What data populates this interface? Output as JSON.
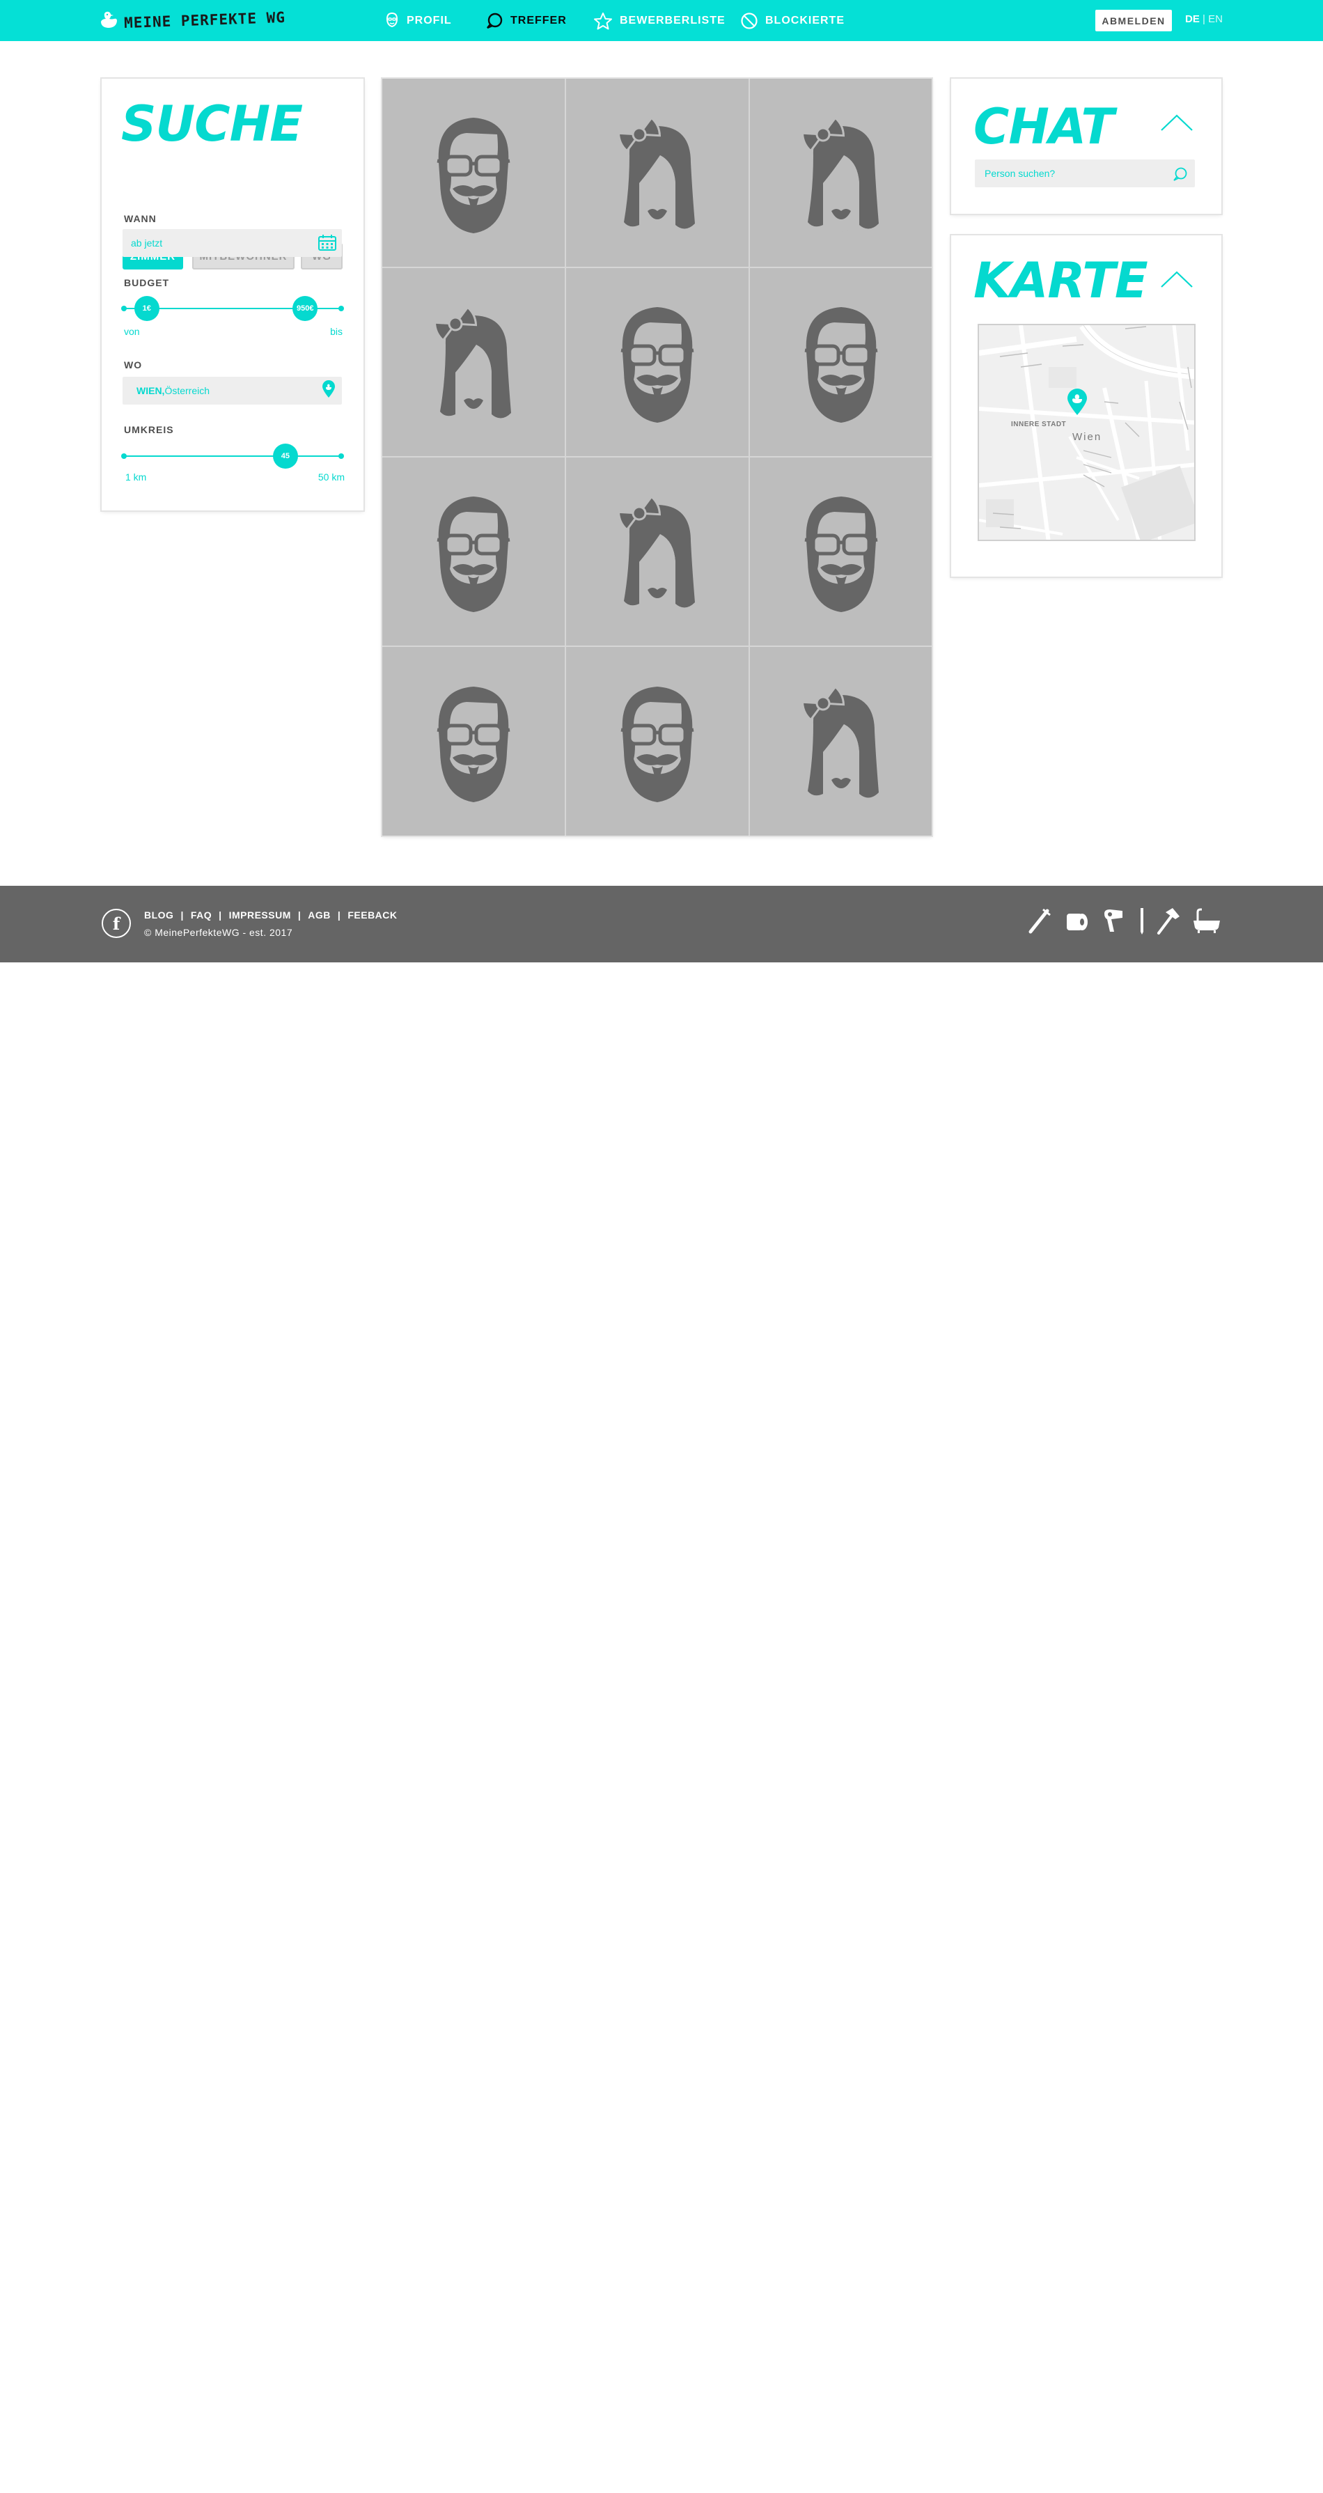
{
  "header": {
    "brand": "Meine Perfekte WG",
    "nav": [
      {
        "label": "PROFIL",
        "icon": "face-icon",
        "active": false
      },
      {
        "label": "TREFFER",
        "icon": "chat-bubble-icon",
        "active": true
      },
      {
        "label": "BEWERBERLISTE",
        "icon": "star-icon",
        "active": false
      },
      {
        "label": "BLOCKIERTE",
        "icon": "block-icon",
        "active": false
      }
    ],
    "logout_label": "ABMELDEN",
    "lang_de": "DE",
    "lang_sep": " | ",
    "lang_en": "EN"
  },
  "search": {
    "title": "SUCHE",
    "tabs": [
      {
        "label": "ZIMMER",
        "selected": true
      },
      {
        "label": "MITBEWOHNER",
        "selected": false
      },
      {
        "label": "WG",
        "selected": false
      }
    ],
    "when_label": "WANN",
    "when_value": "ab jetzt",
    "budget_label": "BUDGET",
    "budget_min": "1€",
    "budget_max": "950€",
    "budget_from": "von",
    "budget_to": "bis",
    "budget_min_fraction": 0.11,
    "budget_max_fraction": 0.83,
    "where_label": "WO",
    "where_city": "WIEN,",
    "where_country": " Österreich",
    "radius_label": "UMKREIS",
    "radius_value": "45",
    "radius_fraction": 0.74,
    "radius_min": "1 km",
    "radius_max": "50 km"
  },
  "matches": [
    "male",
    "female",
    "female",
    "female",
    "male",
    "male",
    "male",
    "female",
    "male",
    "male",
    "male",
    "female"
  ],
  "chat": {
    "title": "CHAT",
    "placeholder": "Person suchen?"
  },
  "map": {
    "title": "KARTE",
    "district": "INNERE STADT",
    "city": "Wien"
  },
  "footer": {
    "facebook": "f",
    "links": [
      "BLOG",
      "FAQ",
      "IMPRESSUM",
      "AGB",
      "FEEBACK"
    ],
    "copyright": "© MeinePerfekteWG - est. 2017",
    "icons": [
      "toothbrush-icon",
      "toilet-paper-icon",
      "hairdryer-icon",
      "pen-icon",
      "hammer-icon",
      "bathtub-icon"
    ]
  },
  "colors": {
    "accent": "#05e0d6",
    "tile": "#bdbdbd",
    "footer": "#656565"
  }
}
